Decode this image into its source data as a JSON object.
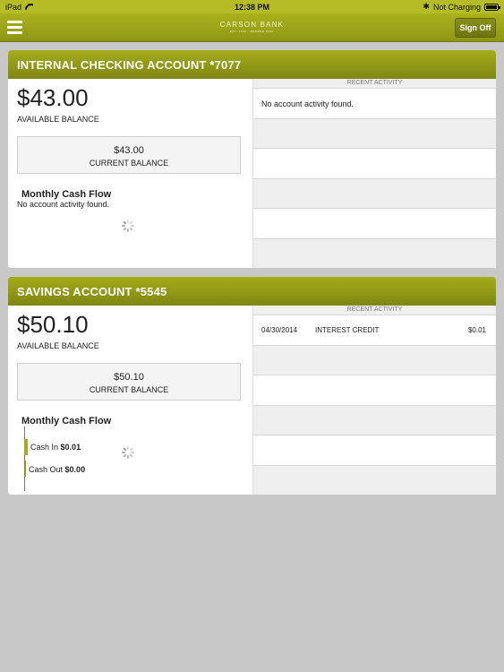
{
  "status_bar": {
    "device": "iPad",
    "time": "12:38 PM",
    "charging": "Not Charging",
    "bluetooth": "bluetooth-icon",
    "wifi": "wifi-icon",
    "battery": "battery-icon"
  },
  "nav": {
    "logo": "CARSON BANK",
    "logo_sub": "EST. 1906 · MEMBER FDIC",
    "sign_off": "Sign Off",
    "menu_icon": "hamburger-menu-icon"
  },
  "colors": {
    "accent": "#a4ad1a",
    "accent_dark": "#7f8612",
    "background": "#c8c8c8"
  },
  "accounts": [
    {
      "title": "INTERNAL CHECKING ACCOUNT *7077",
      "available_balance": "$43.00",
      "available_label": "AVAILABLE BALANCE",
      "current_balance": "$43.00",
      "current_label": "CURRENT BALANCE",
      "cash_flow_title": "Monthly Cash Flow",
      "cash_flow_message": "No account activity found.",
      "recent_activity_label": "RECENT ACTIVITY",
      "recent_activity_message": "No account activity found.",
      "transactions": []
    },
    {
      "title": "SAVINGS ACCOUNT *5545",
      "available_balance": "$50.10",
      "available_label": "AVAILABLE BALANCE",
      "current_balance": "$50.10",
      "current_label": "CURRENT BALANCE",
      "cash_flow_title": "Monthly Cash Flow",
      "cash_in_label": "Cash In",
      "cash_in_value": "$0.01",
      "cash_out_label": "Cash Out",
      "cash_out_value": "$0.00",
      "recent_activity_label": "RECENT ACTIVITY",
      "transactions": [
        {
          "date": "04/30/2014",
          "description": "INTEREST CREDIT",
          "amount": "$0.01"
        }
      ]
    }
  ]
}
